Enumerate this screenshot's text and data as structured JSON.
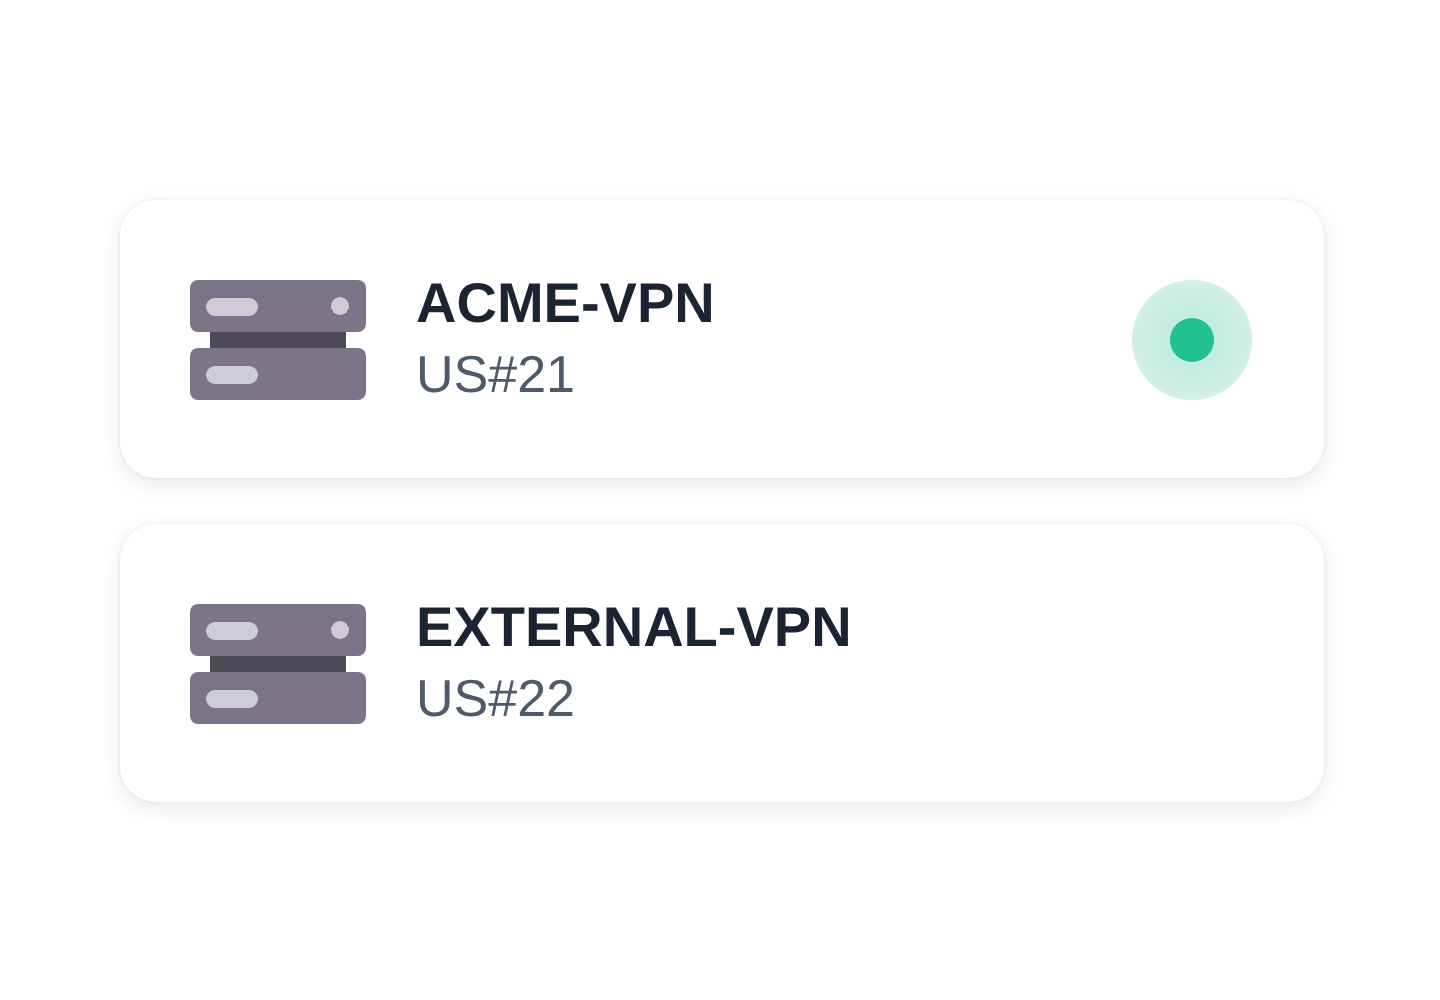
{
  "servers": [
    {
      "name": "ACME-VPN",
      "location": "US#21",
      "connected": true
    },
    {
      "name": "EXTERNAL-VPN",
      "location": "US#22",
      "connected": false
    }
  ]
}
